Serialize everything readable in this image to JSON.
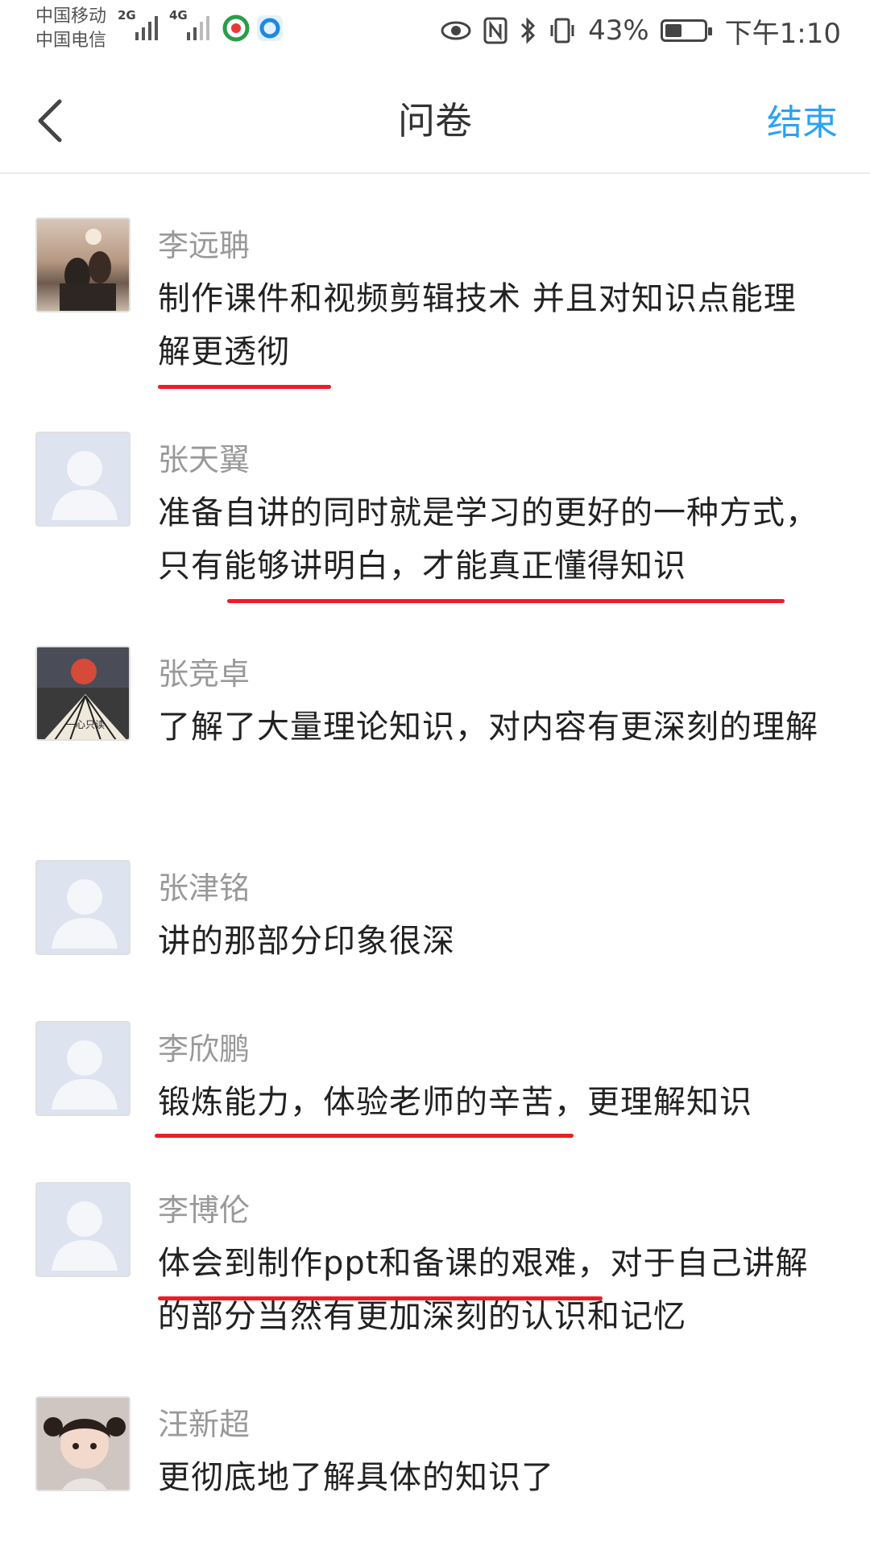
{
  "status_bar": {
    "carrier_1": "中国移动",
    "carrier_2": "中国电信",
    "network_1": "2G",
    "network_2": "4G",
    "battery_percent": "43%",
    "battery_level": 0.43,
    "time": "下午1:10",
    "icons": [
      "eye-icon",
      "nfc-icon",
      "bluetooth-icon",
      "vibrate-icon"
    ]
  },
  "nav": {
    "back_icon": "chevron-left-icon",
    "title": "问卷",
    "action": "结束"
  },
  "colors": {
    "accent": "#2ba2f4",
    "underline": "#ef1b26"
  },
  "responses": [
    {
      "name": "李远聃",
      "avatar": "photo-avatar",
      "comment": "制作课件和视频剪辑技术  并且对知识点能理解更透彻"
    },
    {
      "name": "张天翼",
      "avatar": "default-avatar",
      "comment": "准备自讲的同时就是学习的更好的一种方式，只有能够讲明白，才能真正懂得知识"
    },
    {
      "name": "张竞卓",
      "avatar": "photo-avatar",
      "comment": "了解了大量理论知识，对内容有更深刻的理解"
    },
    {
      "name": "张津铭",
      "avatar": "default-avatar",
      "comment": "讲的那部分印象很深"
    },
    {
      "name": "李欣鹏",
      "avatar": "default-avatar",
      "comment": "锻炼能力，体验老师的辛苦，更理解知识"
    },
    {
      "name": "李博伦",
      "avatar": "default-avatar",
      "comment": "体会到制作ppt和备课的艰难，对于自己讲解的部分当然有更加深刻的认识和记忆"
    },
    {
      "name": "汪新超",
      "avatar": "photo-avatar",
      "comment": "更彻底地了解具体的知识了"
    }
  ]
}
